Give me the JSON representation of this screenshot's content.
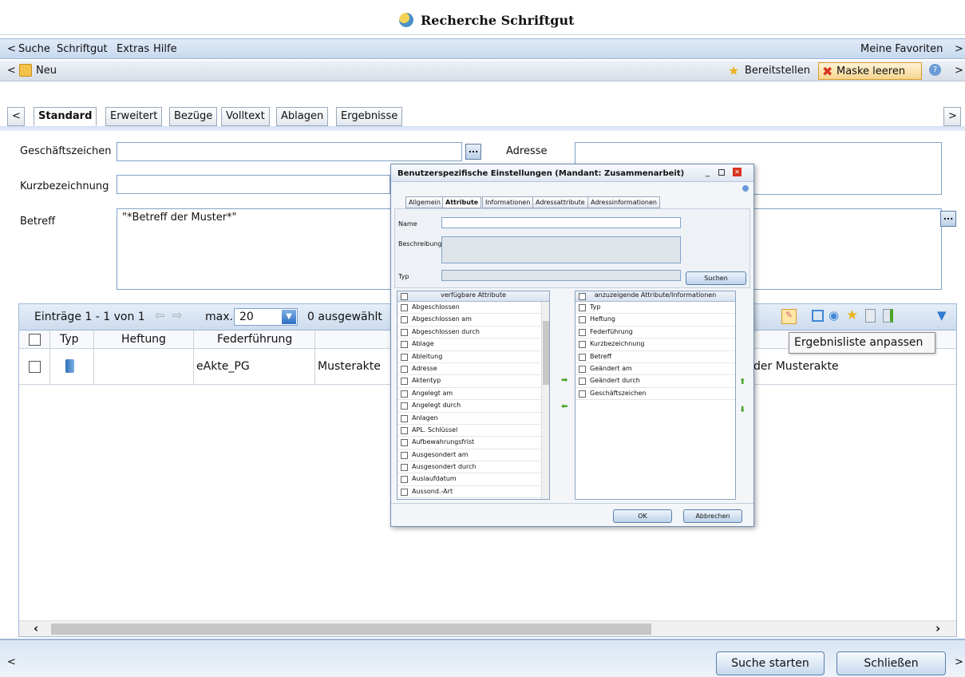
{
  "window": {
    "title": "Recherche Schriftgut"
  },
  "menu": {
    "back": "<",
    "items": [
      "Suche",
      "Schriftgut",
      "Extras",
      "Hilfe"
    ],
    "favorites": "Meine Favoriten",
    "forward": ">"
  },
  "toolbar": {
    "back": "<",
    "new_label": "Neu",
    "provide_label": "Bereitstellen",
    "clear_label": "Maske leeren",
    "forward": ">"
  },
  "tabs": {
    "back": "<",
    "items": [
      "Standard",
      "Erweitert",
      "Bezüge",
      "Volltext",
      "Ablagen",
      "Ergebnisse"
    ],
    "active": "Standard",
    "forward": ">"
  },
  "form": {
    "geschaeftszeichen_label": "Geschäftszeichen",
    "adresse_label": "Adresse",
    "kurzbezeichnung_label": "Kurzbezeichnung",
    "betreff_label": "Betreff",
    "betreff_value": "\"*Betreff der Muster*\"",
    "dots": "..."
  },
  "results": {
    "entries": "Einträge 1 - 1 von 1",
    "max_label": "max.",
    "max_value": "20",
    "selected": "0 ausgewählt",
    "columns": [
      "Typ",
      "Heftung",
      "Federführung"
    ],
    "rows": [
      {
        "heftung": "",
        "federfuehrung": "eAkte_PG",
        "extra": "Musterakte",
        "betreff": "der Musterakte"
      }
    ],
    "tooltip": "Ergebnisliste anpassen"
  },
  "dialog": {
    "title": "Benutzerspezifische Einstellungen (Mandant: Zusammenarbeit)",
    "tabs": [
      "Allgemein",
      "Attribute",
      "Informationen",
      "Adressattribute",
      "Adressinformationen"
    ],
    "active_tab": "Attribute",
    "name_label": "Name",
    "beschreibung_label": "Beschreibung",
    "typ_label": "Typ",
    "search_button": "Suchen",
    "available_header": "verfügbare Attribute",
    "available": [
      "Abgeschlossen",
      "Abgeschlossen am",
      "Abgeschlossen durch",
      "Ablage",
      "Ableitung",
      "Adresse",
      "Aktentyp",
      "Angelegt am",
      "Angelegt durch",
      "Anlagen",
      "APL. Schlüssel",
      "Aufbewahrungsfrist",
      "Ausgesondert am",
      "Ausgesondert durch",
      "Auslaufdatum",
      "Aussond.-Art"
    ],
    "shown_header": "anzuzeigende Attribute/Informationen",
    "shown": [
      "Typ",
      "Heftung",
      "Federführung",
      "Kurzbezeichnung",
      "Betreff",
      "Geändert am",
      "Geändert durch",
      "Geschäftszeichen"
    ],
    "ok": "OK",
    "cancel": "Abbrechen"
  },
  "footer": {
    "back": "<",
    "start": "Suche starten",
    "close": "Schließen",
    "forward": ">"
  },
  "colors": {
    "accent": "#7fa3c9",
    "bar": "#c8d9ee"
  }
}
